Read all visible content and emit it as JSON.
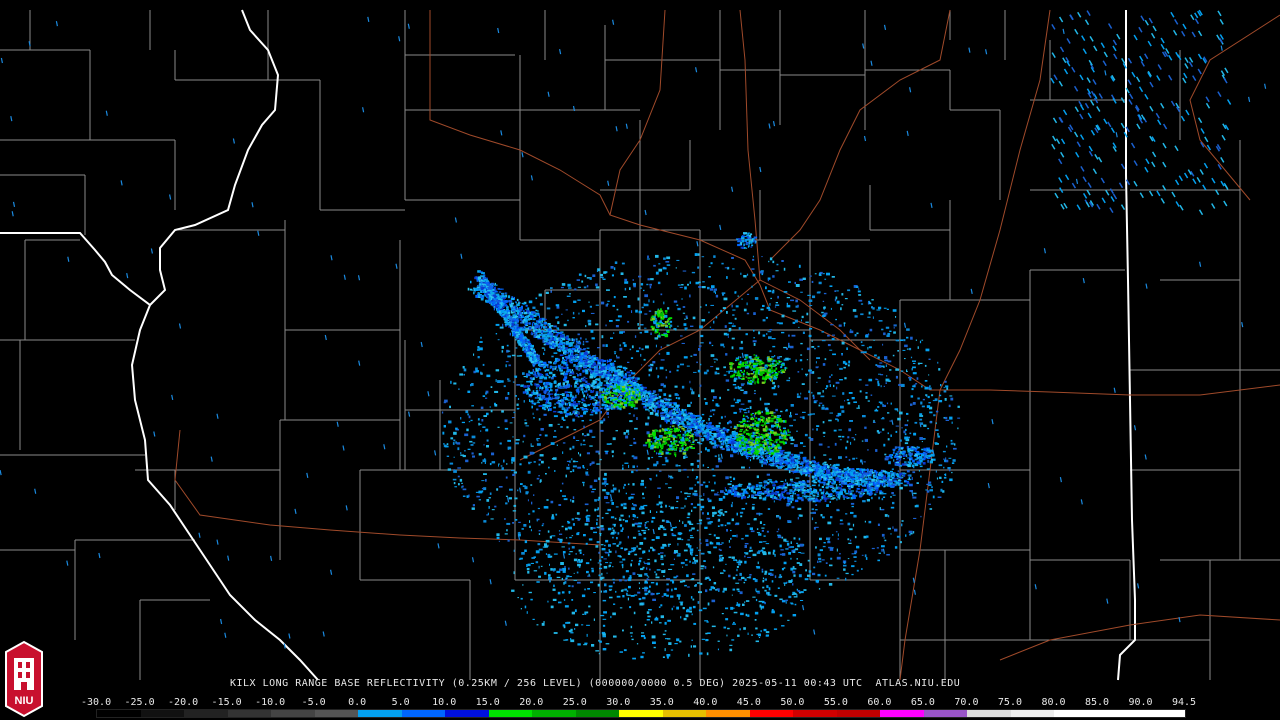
{
  "product_title": "KILX LONG RANGE BASE REFLECTIVITY (0.25KM / 256 LEVEL) (000000/0000 0.5 DEG) 2025-05-11 00:43 UTC  ATLAS.NIU.EDU",
  "logo": {
    "icon": "niu-huskie-tower-logo",
    "text": "NIU",
    "color": "#c8102e"
  },
  "colors": {
    "background": "#000000",
    "county_lines": "#8a8a8a",
    "state_lines": "#ffffff",
    "highways": "#a04a2a"
  },
  "scale": {
    "labels": [
      "-30.0",
      "-25.0",
      "-20.0",
      "-15.0",
      "-10.0",
      "-5.0",
      "0.0",
      "5.0",
      "10.0",
      "15.0",
      "20.0",
      "25.0",
      "30.0",
      "35.0",
      "40.0",
      "45.0",
      "50.0",
      "55.0",
      "60.0",
      "65.0",
      "70.0",
      "75.0",
      "80.0",
      "85.0",
      "90.0",
      "94.5"
    ],
    "colors": [
      "#000000",
      "#111111",
      "#222222",
      "#333333",
      "#444444",
      "#555555",
      "#03a0f0",
      "#0066ff",
      "#0010dd",
      "#00e000",
      "#00b000",
      "#008800",
      "#ffff00",
      "#e6c000",
      "#ff9000",
      "#ff0000",
      "#d00000",
      "#c00000",
      "#ff00ff",
      "#9955c8",
      "#dddddd",
      "#eeeeee",
      "#ffffff",
      "#ffffff",
      "#ffffff"
    ]
  }
}
